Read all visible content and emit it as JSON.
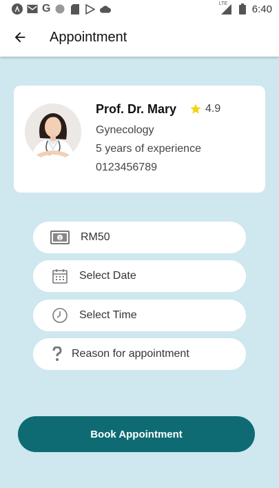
{
  "status_bar": {
    "time": "6:40",
    "network_label": "LTE",
    "icons": [
      "angular-icon",
      "mail-icon",
      "google-icon",
      "circle-icon",
      "sim-card-icon",
      "play-store-icon",
      "cloud-icon",
      "signal-icon",
      "battery-icon"
    ]
  },
  "app_bar": {
    "title": "Appointment",
    "back_icon": "arrow-left-icon"
  },
  "doctor": {
    "name": "Prof. Dr. Mary",
    "rating": "4.9",
    "specialty": "Gynecology",
    "experience": "5 years of experience",
    "phone": "0123456789"
  },
  "form": {
    "fee": "RM50",
    "date_placeholder": "Select Date",
    "time_placeholder": "Select Time",
    "reason_placeholder": "Reason for appointment"
  },
  "book_button": {
    "label": "Book Appointment"
  },
  "colors": {
    "background": "#cfe7ef",
    "primary": "#0f6b73",
    "star": "#f5d20f",
    "card": "#ffffff"
  }
}
